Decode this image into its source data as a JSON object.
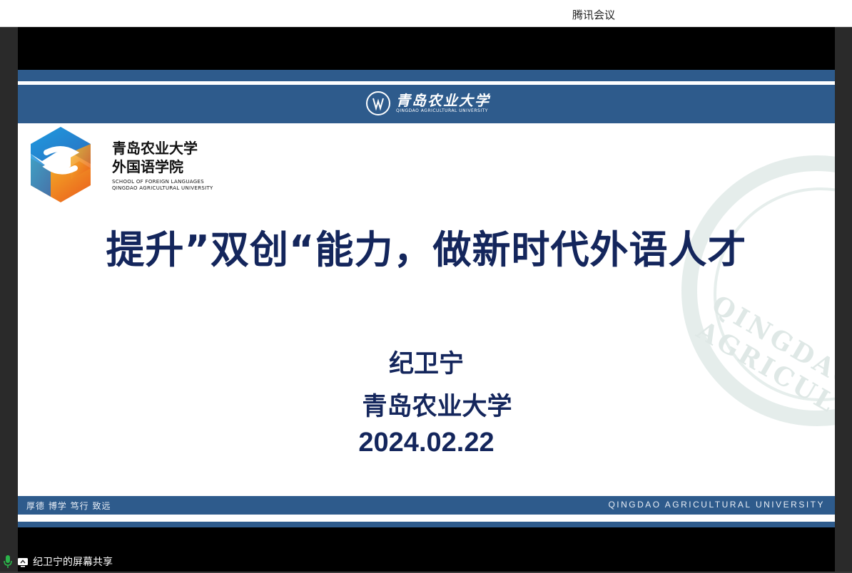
{
  "window": {
    "app_title": "腾讯会议"
  },
  "slide": {
    "university_logo": {
      "name_cn": "青岛农业大学",
      "name_en": "QINGDAO AGRICULTURAL UNIVERSITY"
    },
    "school": {
      "name_cn_line1": "青岛农业大学",
      "name_cn_line2": "外国语学院",
      "name_en_line1": "SCHOOL OF FOREIGN LANGUAGES",
      "name_en_line2": "QINGDAO AGRICULTURAL UNIVERSITY"
    },
    "title": "提升”双创“能力，做新时代外语人才",
    "presenter_name": "纪卫宁",
    "presenter_org": "青岛农业大学",
    "date": "2024.02.22",
    "footer_motto": "厚德 博学 笃行 致远",
    "footer_en": "QINGDAO AGRICULTURAL UNIVERSITY",
    "watermark_text": "QINGDAO AGRICUL"
  },
  "status_bar": {
    "share_label": "纪卫宁的屏幕共享",
    "mic_icon": "mic-icon",
    "screen_icon": "screen-share-icon"
  },
  "colors": {
    "brand_blue": "#2e5b8c",
    "title_navy": "#14265c",
    "mic_green": "#2bb34a"
  }
}
